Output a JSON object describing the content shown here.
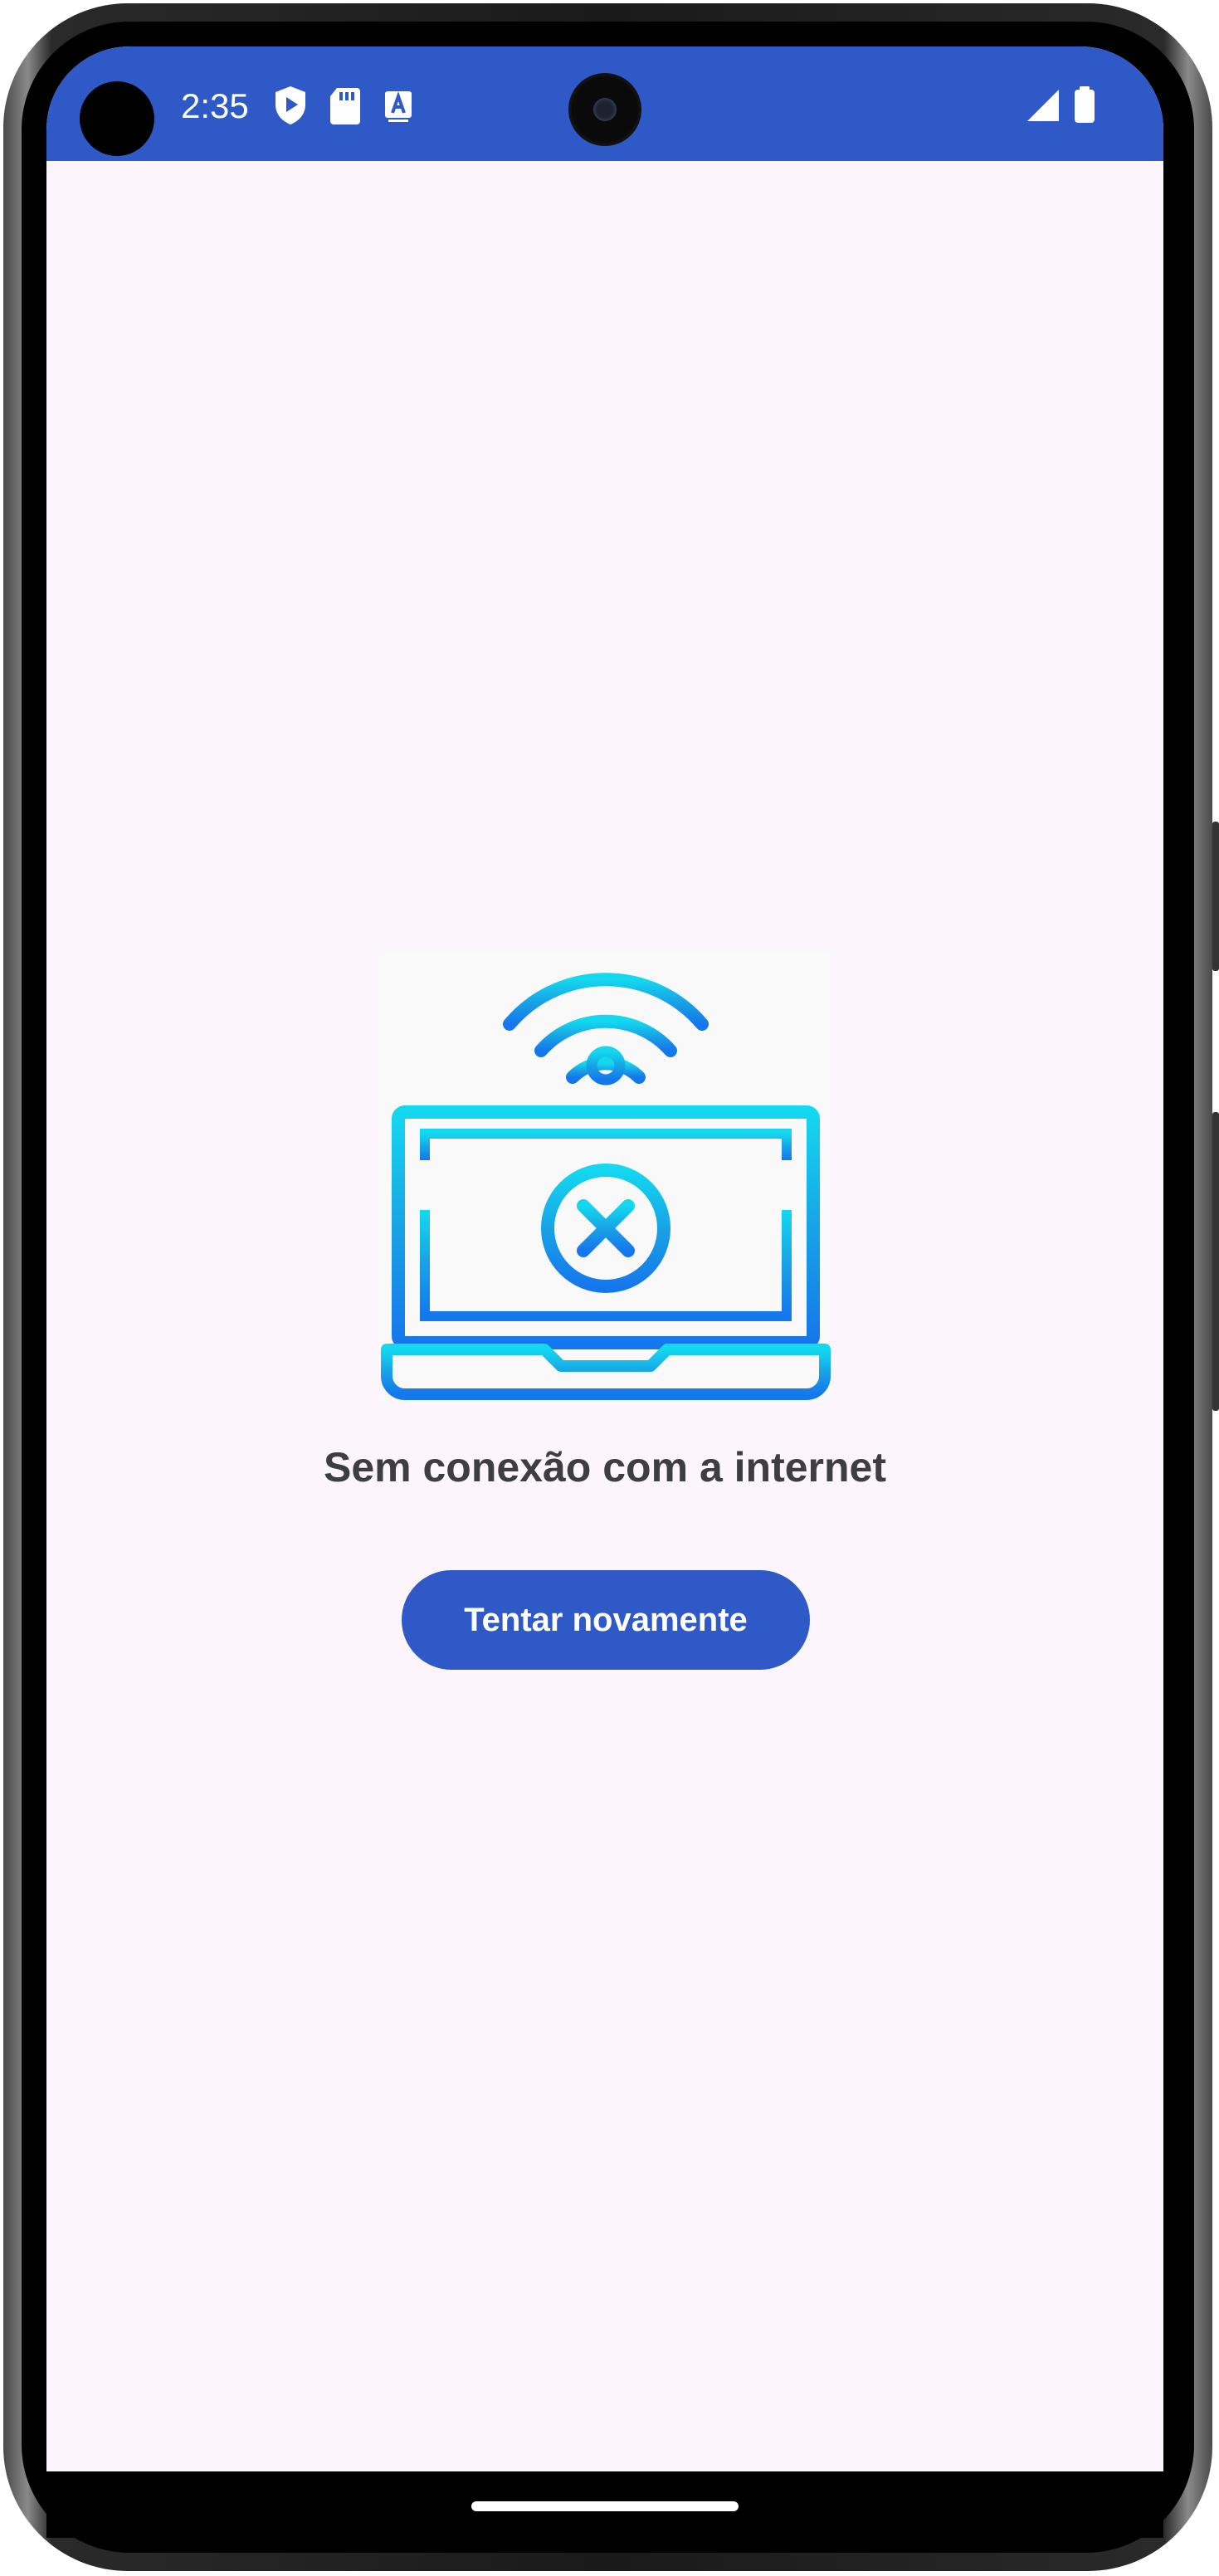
{
  "status_bar": {
    "time": "2:35",
    "icons": [
      "play-protect-icon",
      "sd-card-icon",
      "font-a-icon",
      "cell-signal-icon",
      "battery-icon"
    ],
    "background_color": "#2f59c7"
  },
  "no_connection": {
    "illustration": "laptop-wifi-disconnected-icon",
    "message": "Sem conexão com a internet",
    "retry_button_label": "Tentar novamente",
    "accent_color": "#2f59c7"
  }
}
